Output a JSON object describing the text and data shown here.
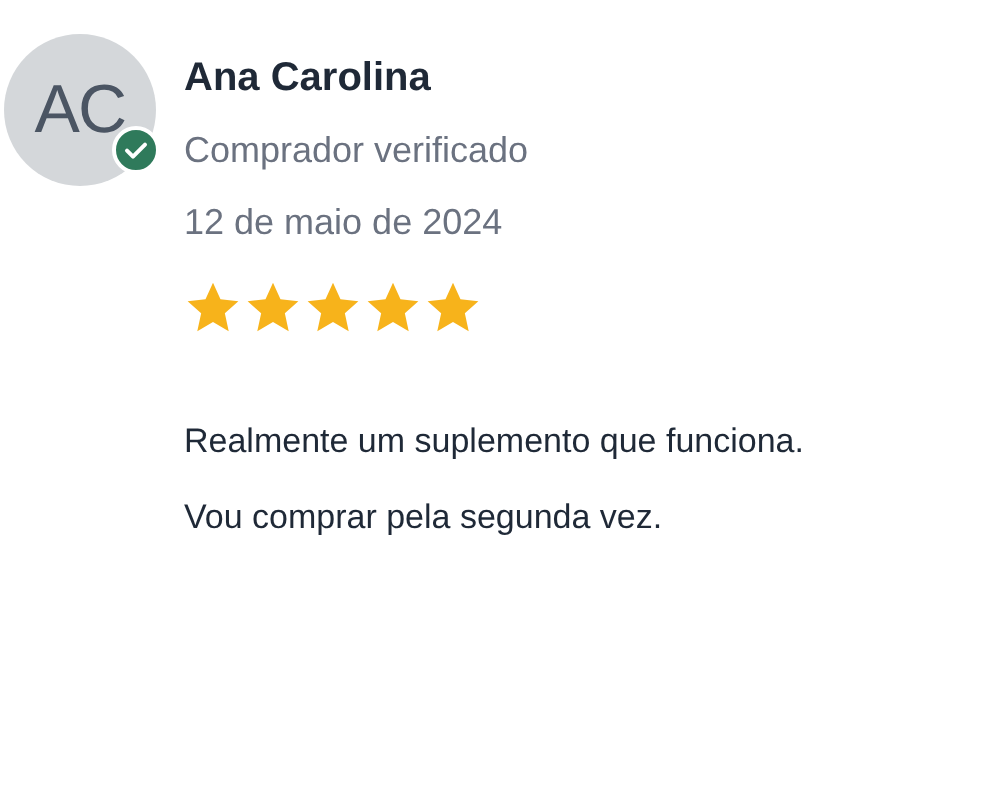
{
  "review": {
    "avatar_initials": "AC",
    "verified": true,
    "author": "Ana Carolina",
    "badge": "Comprador verificado",
    "date": "12 de maio de 2024",
    "stars": 5,
    "text_lines": [
      "Realmente um suplemento que funciona.",
      "Vou comprar pela segunda vez."
    ]
  }
}
